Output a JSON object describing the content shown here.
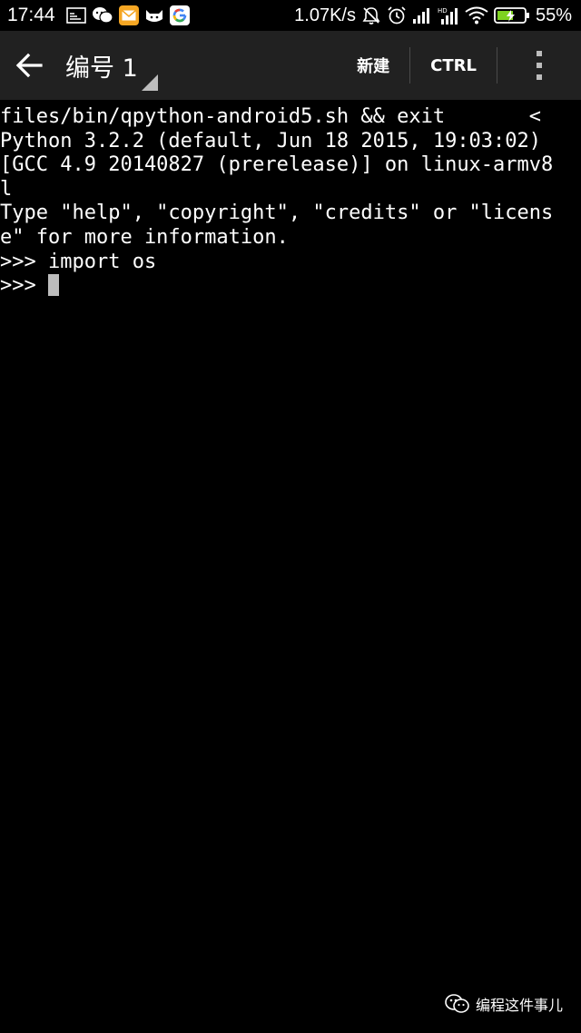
{
  "status_bar": {
    "time": "17:44",
    "net_speed": "1.07K/s",
    "battery_percent": "55%",
    "left_icons": [
      "gallery-icon",
      "wechat-icon",
      "mail-icon",
      "cat-icon",
      "google-icon"
    ],
    "right_icons": [
      "mute-icon",
      "alarm-icon",
      "signal-icon",
      "signal-hd-icon",
      "wifi-icon",
      "battery-icon"
    ]
  },
  "toolbar": {
    "back_icon": "arrow-left-icon",
    "title": "编号 1",
    "new_label": "新建",
    "ctrl_label": "CTRL",
    "overflow_icon": "more-vertical-icon"
  },
  "terminal": {
    "lines": [
      "files/bin/qpython-android5.sh && exit       <",
      "Python 3.2.2 (default, Jun 18 2015, 19:03:02)",
      "[GCC 4.9 20140827 (prerelease)] on linux-armv8",
      "l",
      "Type \"help\", \"copyright\", \"credits\" or \"licens",
      "e\" for more information.",
      ">>> import os"
    ],
    "prompt": ">>> "
  },
  "watermark": {
    "icon": "wechat-official-icon",
    "text": "编程这件事儿"
  },
  "colors": {
    "toolbar_bg": "#212121",
    "terminal_bg": "#000000",
    "terminal_fg": "#ffffff",
    "cursor": "#bdbdbd",
    "battery_accent": "#7ed321"
  }
}
